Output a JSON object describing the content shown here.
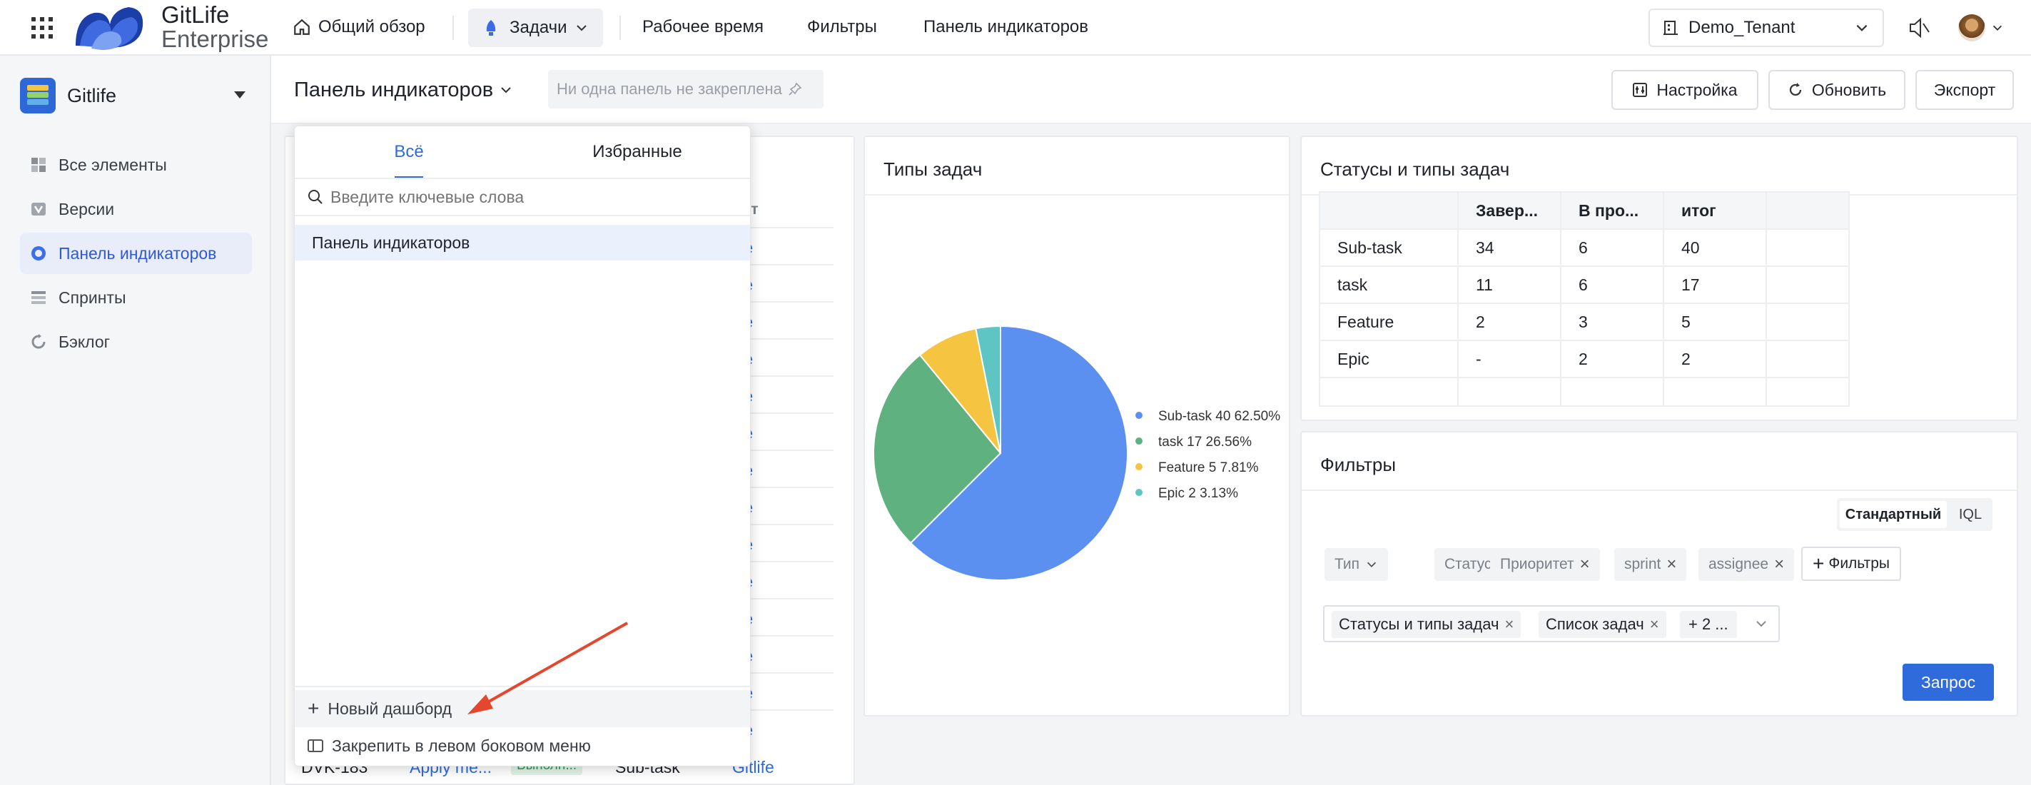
{
  "topbar": {
    "brand_line1": "GitLife",
    "brand_line2": "Enterprise",
    "overview": "Общий обзор",
    "tasks": "Задачи",
    "work_time": "Рабочее время",
    "filters": "Фильтры",
    "dashboard": "Панель индикаторов",
    "tenant": "Demo_Tenant"
  },
  "sidebar": {
    "project": "Gitlife",
    "items": [
      {
        "label": "Все элементы",
        "icon": "grid-icon"
      },
      {
        "label": "Версии",
        "icon": "version-icon"
      },
      {
        "label": "Панель индикаторов",
        "icon": "dashboard-icon"
      },
      {
        "label": "Спринты",
        "icon": "sprint-icon"
      },
      {
        "label": "Бэклог",
        "icon": "backlog-icon"
      }
    ]
  },
  "header": {
    "dashboard_select": "Панель индикаторов",
    "pin_placeholder": "Ни одна панель не закреплена",
    "settings": "Настройка",
    "refresh": "Обновить",
    "export": "Экспорт"
  },
  "popup": {
    "tab_all": "Всё",
    "tab_fav": "Избранные",
    "search_placeholder": "Введите ключевые слова",
    "item": "Панель индикаторов",
    "new_dashboard": "Новый дашборд",
    "pin_left": "Закрепить в левом боковом меню"
  },
  "task_list": {
    "col_project": "ект",
    "project_link": "fe",
    "last_row": {
      "key": "DVK-183",
      "title": "Apply me...",
      "status": "Выполн...",
      "type": "Sub-task",
      "project": "Gitlife"
    }
  },
  "pie_card": {
    "title": "Типы задач"
  },
  "status_card": {
    "title": "Статусы и типы задач",
    "headers": [
      "",
      "Завер...",
      "В про...",
      "итог"
    ],
    "rows": [
      [
        "Sub-task",
        "34",
        "6",
        "40"
      ],
      [
        "task",
        "11",
        "6",
        "17"
      ],
      [
        "Feature",
        "2",
        "3",
        "5"
      ],
      [
        "Epic",
        "-",
        "2",
        "2"
      ]
    ]
  },
  "filters_card": {
    "title": "Фильтры",
    "mode_std": "Стандартный",
    "mode_iql": "IQL",
    "chips": [
      "Тип",
      "Статус",
      "Приоритет",
      "sprint",
      "assignee"
    ],
    "add_filter": "Фильтры",
    "tags": [
      "Статусы и типы задач",
      "Список задач",
      "+ 2 ..."
    ],
    "query": "Запрос"
  },
  "colors": {
    "accent": "#2f6bdb",
    "subtask": "#5b8ff0",
    "task": "#5fb17f",
    "feature": "#f5c542",
    "epic": "#5ec4c4"
  },
  "chart_data": {
    "type": "pie",
    "title": "Типы задач",
    "labels": [
      "Sub-task",
      "task",
      "Feature",
      "Epic"
    ],
    "values": [
      40,
      17,
      5,
      2
    ],
    "percent_labels": [
      "62.50%",
      "26.56%",
      "7.81%",
      "3.13%"
    ],
    "legend": "right"
  }
}
